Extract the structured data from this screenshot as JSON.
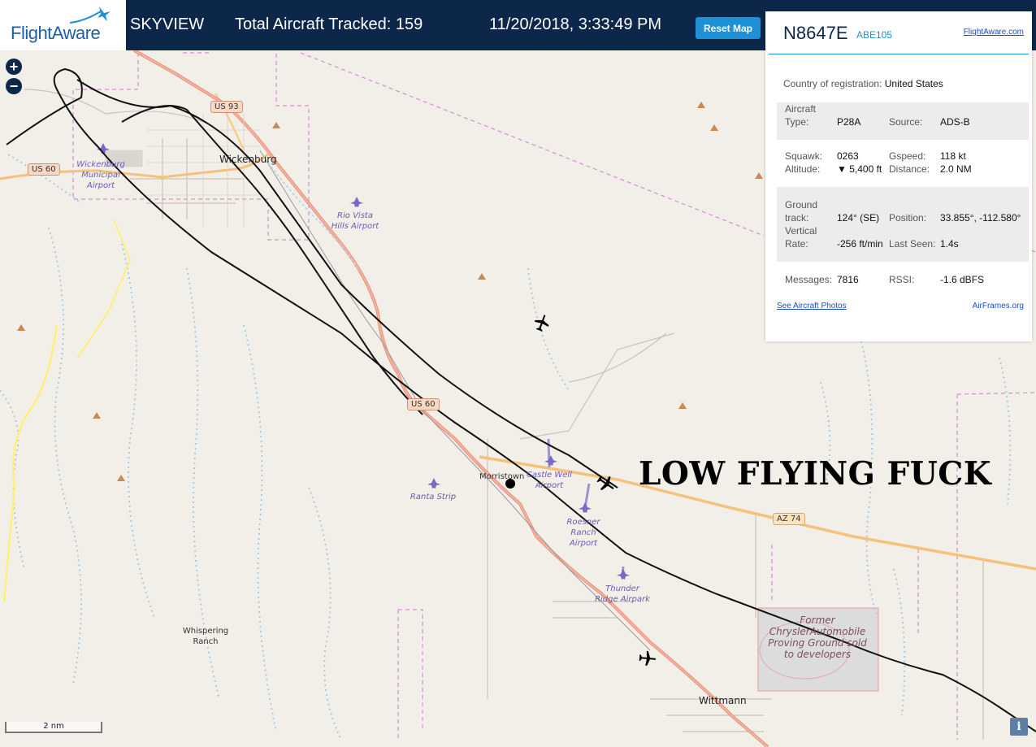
{
  "header": {
    "logo_text": "FlightAware",
    "app_name": "SKYVIEW",
    "tracked_label": "Total Aircraft Tracked: 159",
    "timestamp": "11/20/2018, 3:33:49 PM",
    "reset_label": "Reset Map"
  },
  "panel": {
    "registration": "N8647E",
    "callsign": "ABE105",
    "link_flightaware": "FlightAware.com",
    "country_label": "Country of registration:",
    "country_value": "United States",
    "aircraft_type_label": "Aircraft Type:",
    "aircraft_type_value": "P28A",
    "source_label": "Source:",
    "source_value": "ADS-B",
    "squawk_label": "Squawk:",
    "squawk_value": "0263",
    "gspeed_label": "Gspeed:",
    "gspeed_value": "118 kt",
    "altitude_label": "Altitude:",
    "altitude_value": "▼ 5,400 ft",
    "distance_label": "Distance:",
    "distance_value": "2.0 NM",
    "ground_track_label": "Ground track:",
    "ground_track_value": "124° (SE)",
    "position_label": "Position:",
    "position_value": "33.855°, -112.580°",
    "vertical_rate_label": "Vertical Rate:",
    "vertical_rate_value": "-256 ft/min",
    "last_seen_label": "Last Seen:",
    "last_seen_value": "1.4s",
    "messages_label": "Messages:",
    "messages_value": "7816",
    "rssi_label": "RSSI:",
    "rssi_value": "-1.6 dBFS",
    "photos_link": "See Aircraft Photos",
    "airframes_link": "AirFrames.org"
  },
  "map": {
    "zoom_in": "+",
    "zoom_out": "−",
    "towns": {
      "wickenburg": "Wickenburg",
      "morristown": "Morristown",
      "wittmann": "Wittmann",
      "whispering_ranch": "Whispering Ranch"
    },
    "airports": {
      "wickenburg": "Wickenburg Municipal Airport",
      "rio_vista": "Rio Vista Hills Airport",
      "castle_well": "Castle Well Airport",
      "ranta": "Ranta Strip",
      "roesner": "Roesner Ranch Airport",
      "thunder_ridge": "Thunder Ridge Airpark"
    },
    "proving_ground": "Former ChryslerAutomobile Proving Ground sold to developers",
    "roads": {
      "us93": "US 93",
      "us60_west": "US 60",
      "us60_mid": "US 60",
      "az74": "AZ 74"
    },
    "scale": "2 nm",
    "info_icon": "i"
  },
  "annotation": "LOW FLYING FUCK",
  "colors": {
    "header_bg": "#0c2749",
    "accent": "#1e90d6",
    "map_bg": "#f2efe9",
    "highway": "#e8927c",
    "secondary_road": "#f6c17a",
    "track": "#000000"
  }
}
